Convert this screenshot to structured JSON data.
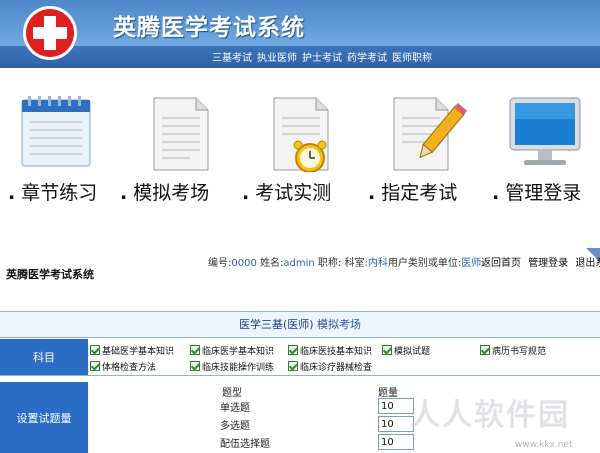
{
  "header": {
    "title": "英腾医学考试系统",
    "nav_links": [
      "三基考试",
      "执业医师",
      "护士考试",
      "药学考试",
      "医师职称"
    ]
  },
  "tiles": [
    {
      "label": "章节练习",
      "icon": "calendar-notebook-icon"
    },
    {
      "label": "模拟考场",
      "icon": "document-icon"
    },
    {
      "label": "考试实测",
      "icon": "document-alarm-clock-icon"
    },
    {
      "label": "指定考试",
      "icon": "document-pencil-icon"
    },
    {
      "label": "管理登录",
      "icon": "monitor-icon"
    }
  ],
  "lower": {
    "system_name": "英腾医学考试系统",
    "user": {
      "id_label": "编号:",
      "id": "0000",
      "name_label": "姓名:",
      "name": "admin",
      "title_label": "职称:",
      "dept_label": "科室:",
      "dept": "内科",
      "unit_label": "用户类别或单位:",
      "unit": "医师"
    },
    "links": [
      "返回首页",
      "管理登录",
      "退出系统"
    ]
  },
  "exam": {
    "title_prefix": "医学三基(医师)",
    "title_suffix": "模拟考场",
    "subject_label": "科目",
    "subjects": [
      "基础医学基本知识",
      "临床医学基本知识",
      "临床医技基本知识",
      "模拟试题",
      "病历书写规范",
      "体格检查方法",
      "临床技能操作训练",
      "临床诊疗器械检查"
    ],
    "count_label": "设置试题量",
    "col_type": "题型",
    "col_count": "题量",
    "rows": [
      {
        "type": "单选题",
        "count": "10"
      },
      {
        "type": "多选题",
        "count": "10"
      },
      {
        "type": "配伍选择题",
        "count": "10"
      }
    ]
  },
  "watermark": {
    "text": "人人软件园",
    "url": "www.kkx.net"
  },
  "colors": {
    "banner": "#5b93d4",
    "label_cell": "#2b6cc4",
    "link_blue": "#2a5fb5",
    "logo_red": "#e02020"
  }
}
